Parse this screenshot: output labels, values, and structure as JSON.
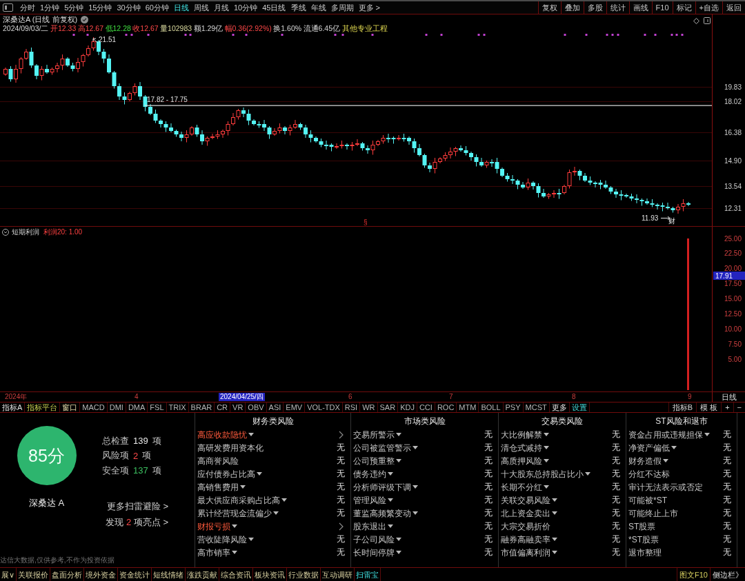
{
  "toolbar": {
    "periods": [
      {
        "label": "分时",
        "selected": false
      },
      {
        "label": "1分钟",
        "selected": false
      },
      {
        "label": "5分钟",
        "selected": false
      },
      {
        "label": "15分钟",
        "selected": false
      },
      {
        "label": "30分钟",
        "selected": false
      },
      {
        "label": "60分钟",
        "selected": false
      },
      {
        "label": "日线",
        "selected": true
      },
      {
        "label": "周线",
        "selected": false
      },
      {
        "label": "月线",
        "selected": false
      },
      {
        "label": "10分钟",
        "selected": false
      },
      {
        "label": "45日线",
        "selected": false
      },
      {
        "label": "季线",
        "selected": false
      },
      {
        "label": "年线",
        "selected": false
      },
      {
        "label": "多周期",
        "selected": false
      },
      {
        "label": "更多 >",
        "selected": false
      }
    ],
    "actions": [
      "复权",
      "叠加",
      "多股",
      "统计",
      "画线",
      "F10",
      "标记",
      "+自选",
      "返回"
    ]
  },
  "quote": {
    "title": "深桑达A (日线 前复权)",
    "date": "2024/09/03/二",
    "fields": [
      {
        "text": "开12.33",
        "kind": "up"
      },
      {
        "text": "高12.67",
        "kind": "up"
      },
      {
        "text": "低12.28",
        "kind": "down"
      },
      {
        "text": "收12.67",
        "kind": "up"
      },
      {
        "text": "量102983",
        "kind": "volume"
      },
      {
        "text": "额1.29亿",
        "kind": "plain"
      },
      {
        "text": "幅0.36(2.92%)",
        "kind": "up"
      },
      {
        "text": "换1.60%",
        "kind": "plain"
      },
      {
        "text": "流通6.45亿",
        "kind": "plain"
      }
    ],
    "sector": "其他专业工程"
  },
  "main_chart": {
    "high_label": "21.51",
    "low_label": "11.93",
    "level_label": "17.82 - 17.75",
    "markers": [
      {
        "kind": "section",
        "text": "§"
      },
      {
        "kind": "finance",
        "text": "财"
      }
    ],
    "price_axis": [
      "19.83",
      "18.02",
      "16.38",
      "14.90",
      "13.54",
      "12.31"
    ]
  },
  "indicator_panel": {
    "name": "短期利润",
    "param": "利润20: 1.00",
    "axis": [
      "25.00",
      "22.50",
      "20.00",
      "17.50",
      "15.00",
      "12.50",
      "10.00",
      "7.50",
      "5.00"
    ],
    "current_value": "17.91"
  },
  "time_axis": {
    "labels": [
      {
        "text": "2024年",
        "highlighted": false
      },
      {
        "text": "4",
        "highlighted": false
      },
      {
        "text": "2024/04/25/四",
        "highlighted": true
      },
      {
        "text": "6",
        "highlighted": false
      },
      {
        "text": "7",
        "highlighted": false
      },
      {
        "text": "8",
        "highlighted": false
      },
      {
        "text": "9",
        "highlighted": false
      }
    ],
    "period": "日线"
  },
  "indicator_tabs": {
    "tabs": [
      {
        "label": "指标A",
        "kind": "menu"
      },
      {
        "label": "指标平台",
        "kind": "platform"
      },
      {
        "label": "窗口",
        "kind": "window"
      },
      {
        "label": "MACD",
        "kind": "indicator"
      },
      {
        "label": "DMI",
        "kind": "indicator"
      },
      {
        "label": "DMA",
        "kind": "indicator"
      },
      {
        "label": "FSL",
        "kind": "indicator"
      },
      {
        "label": "TRIX",
        "kind": "indicator"
      },
      {
        "label": "BRAR",
        "kind": "indicator"
      },
      {
        "label": "CR",
        "kind": "indicator"
      },
      {
        "label": "VR",
        "kind": "indicator"
      },
      {
        "label": "OBV",
        "kind": "indicator"
      },
      {
        "label": "ASI",
        "kind": "indicator"
      },
      {
        "label": "EMV",
        "kind": "indicator"
      },
      {
        "label": "VOL-TDX",
        "kind": "indicator"
      },
      {
        "label": "RSI",
        "kind": "indicator"
      },
      {
        "label": "WR",
        "kind": "indicator"
      },
      {
        "label": "SAR",
        "kind": "indicator"
      },
      {
        "label": "KDJ",
        "kind": "indicator"
      },
      {
        "label": "CCI",
        "kind": "indicator"
      },
      {
        "label": "ROC",
        "kind": "indicator"
      },
      {
        "label": "MTM",
        "kind": "indicator"
      },
      {
        "label": "BOLL",
        "kind": "indicator"
      },
      {
        "label": "PSY",
        "kind": "indicator"
      },
      {
        "label": "MCST",
        "kind": "indicator"
      },
      {
        "label": "更多",
        "kind": "menu"
      },
      {
        "label": "设置",
        "kind": "settings"
      }
    ],
    "right": [
      "指标B",
      "模 板",
      "+",
      "−"
    ]
  },
  "risk_scan": {
    "summary": {
      "score": "85分",
      "stock": "深桑达 A",
      "stats": [
        {
          "label": "总检查",
          "count": "139",
          "unit": "项",
          "color": "#e8e8e8"
        },
        {
          "label": "风险项",
          "count": "2",
          "unit": "项",
          "color": "#ff4a4a"
        },
        {
          "label": "安全项",
          "count": "137",
          "unit": "项",
          "color": "#3cc060"
        }
      ],
      "more_link": "更多扫雷避险 >",
      "highlight_link": {
        "prefix": "发现",
        "count": "2",
        "suffix": "项亮点 >"
      },
      "disclaimer": "达信大数据,仅供参考,不作为投资依据"
    },
    "categories": [
      {
        "title": "财务类风险",
        "items": [
          {
            "label": "高应收款隐忧",
            "dropdown": true,
            "risk": true
          },
          {
            "label": "高研发费用资本化",
            "dropdown": false,
            "risk": false,
            "value": "无"
          },
          {
            "label": "高商誉风险",
            "dropdown": false,
            "risk": false,
            "value": "无"
          },
          {
            "label": "应付债券占比高",
            "dropdown": true,
            "risk": false,
            "value": "无"
          },
          {
            "label": "高销售费用",
            "dropdown": true,
            "risk": false,
            "value": "无"
          },
          {
            "label": "最大供应商采购占比高",
            "dropdown": true,
            "risk": false,
            "value": "无"
          },
          {
            "label": "累计经营现金流偏少",
            "dropdown": true,
            "risk": false,
            "value": "无"
          },
          {
            "label": "财报亏损",
            "dropdown": true,
            "risk": true
          },
          {
            "label": "营收陡降风险",
            "dropdown": true,
            "risk": false,
            "value": "无"
          },
          {
            "label": "高市销率",
            "dropdown": true,
            "risk": false,
            "value": "无"
          }
        ]
      },
      {
        "title": "市场类风险",
        "items": [
          {
            "label": "交易所警示",
            "dropdown": true,
            "risk": false,
            "value": "无"
          },
          {
            "label": "公司被监管警示",
            "dropdown": true,
            "risk": false,
            "value": "无"
          },
          {
            "label": "公司预重整",
            "dropdown": true,
            "risk": false,
            "value": "无"
          },
          {
            "label": "债务违约",
            "dropdown": true,
            "risk": false,
            "value": "无"
          },
          {
            "label": "分析师评级下调",
            "dropdown": true,
            "risk": false,
            "value": "无"
          },
          {
            "label": "管理风险",
            "dropdown": true,
            "risk": false,
            "value": "无"
          },
          {
            "label": "董监高频繁变动",
            "dropdown": true,
            "risk": false,
            "value": "无"
          },
          {
            "label": "股东退出",
            "dropdown": true,
            "risk": false,
            "value": "无"
          },
          {
            "label": "子公司风险",
            "dropdown": true,
            "risk": false,
            "value": "无"
          },
          {
            "label": "长时间停牌",
            "dropdown": true,
            "risk": false,
            "value": "无"
          }
        ]
      },
      {
        "title": "交易类风险",
        "items": [
          {
            "label": "大比例解禁",
            "dropdown": true,
            "risk": false,
            "value": "无"
          },
          {
            "label": "清仓式减持",
            "dropdown": true,
            "risk": false,
            "value": "无"
          },
          {
            "label": "高质押风险",
            "dropdown": true,
            "risk": false,
            "value": "无"
          },
          {
            "label": "十大股东总持股占比小",
            "dropdown": true,
            "risk": false,
            "value": "无"
          },
          {
            "label": "长期不分红",
            "dropdown": true,
            "risk": false,
            "value": "无"
          },
          {
            "label": "关联交易风险",
            "dropdown": true,
            "risk": false,
            "value": "无"
          },
          {
            "label": "北上资金卖出",
            "dropdown": true,
            "risk": false,
            "value": "无"
          },
          {
            "label": "大宗交易折价",
            "dropdown": false,
            "risk": false,
            "value": "无"
          },
          {
            "label": "融券高融卖率",
            "dropdown": true,
            "risk": false,
            "value": "无"
          },
          {
            "label": "市值偏离利润",
            "dropdown": true,
            "risk": false,
            "value": "无"
          }
        ]
      },
      {
        "title": "ST风险和退市",
        "items": [
          {
            "label": "资金占用或违规担保",
            "dropdown": true,
            "risk": false,
            "value": "无"
          },
          {
            "label": "净资产偏低",
            "dropdown": true,
            "risk": false,
            "value": "无"
          },
          {
            "label": "财务造假",
            "dropdown": true,
            "risk": false,
            "value": "无"
          },
          {
            "label": "分红不达标",
            "dropdown": false,
            "risk": false,
            "value": "无"
          },
          {
            "label": "审计无法表示或否定",
            "dropdown": false,
            "risk": false,
            "value": "无"
          },
          {
            "label": "可能被*ST",
            "dropdown": false,
            "risk": false,
            "value": "无"
          },
          {
            "label": "可能终止上市",
            "dropdown": false,
            "risk": false,
            "value": "无"
          },
          {
            "label": "ST股票",
            "dropdown": false,
            "risk": false,
            "value": "无"
          },
          {
            "label": "*ST股票",
            "dropdown": false,
            "risk": false,
            "value": "无"
          },
          {
            "label": "退市整理",
            "dropdown": false,
            "risk": false,
            "value": "无"
          }
        ]
      }
    ]
  },
  "bottom_bar": {
    "tabs": [
      {
        "label": "展∨",
        "selected": false
      },
      {
        "label": "关联报价",
        "selected": false
      },
      {
        "label": "盘面分析",
        "selected": false
      },
      {
        "label": "境外资金",
        "selected": false
      },
      {
        "label": "资金统计",
        "selected": false
      },
      {
        "label": "短线情绪",
        "selected": false
      },
      {
        "label": "涨跌贡献",
        "selected": false
      },
      {
        "label": "综合资讯",
        "selected": false
      },
      {
        "label": "板块资讯",
        "selected": false
      },
      {
        "label": "行业数据",
        "selected": false
      },
      {
        "label": "互动调研",
        "selected": false
      },
      {
        "label": "扫雷宝",
        "selected": true
      }
    ],
    "right": [
      "图文F10",
      "侧边栏》"
    ]
  }
}
